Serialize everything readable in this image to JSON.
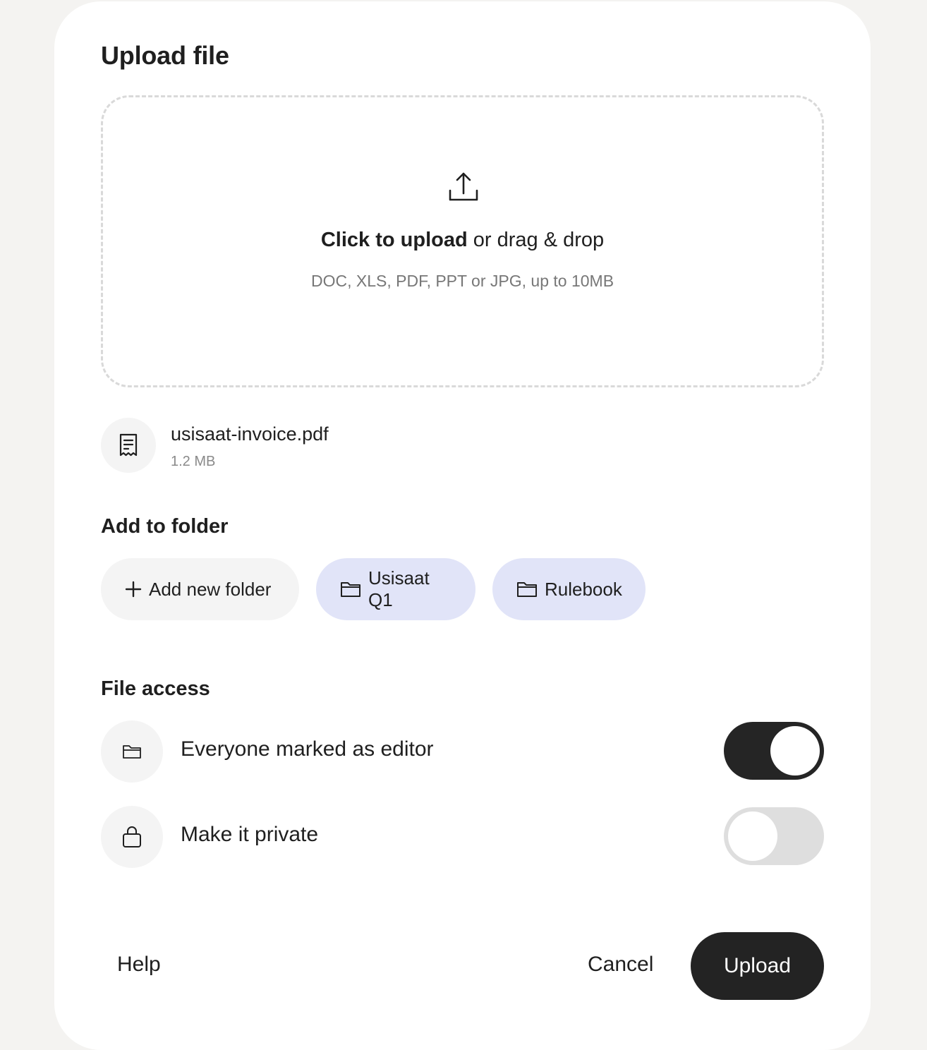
{
  "dialog": {
    "title": "Upload file"
  },
  "dropzone": {
    "icon": "upload-icon",
    "click_text": "Click to upload",
    "drag_text": "or drag & drop",
    "hint": "DOC, XLS, PDF, PPT or JPG, up to 10MB"
  },
  "file": {
    "icon": "receipt-icon",
    "name": "usisaat-invoice.pdf",
    "size": "1.2 MB"
  },
  "folders": {
    "title": "Add to folder",
    "add_label": "Add new folder",
    "items": [
      {
        "label": "Usisaat Q1",
        "icon": "folder-icon"
      },
      {
        "label": "Rulebook",
        "icon": "folder-icon"
      }
    ]
  },
  "access": {
    "title": "File access",
    "options": [
      {
        "label": "Everyone marked as editor",
        "icon": "folder-icon",
        "enabled": true
      },
      {
        "label": "Make it private",
        "icon": "lock-icon",
        "enabled": false
      }
    ]
  },
  "footer": {
    "help_label": "Help",
    "cancel_label": "Cancel",
    "upload_label": "Upload"
  },
  "colors": {
    "primary": "#232323",
    "folder_chip": "#e1e4f8",
    "neutral_chip": "#f4f4f4"
  }
}
